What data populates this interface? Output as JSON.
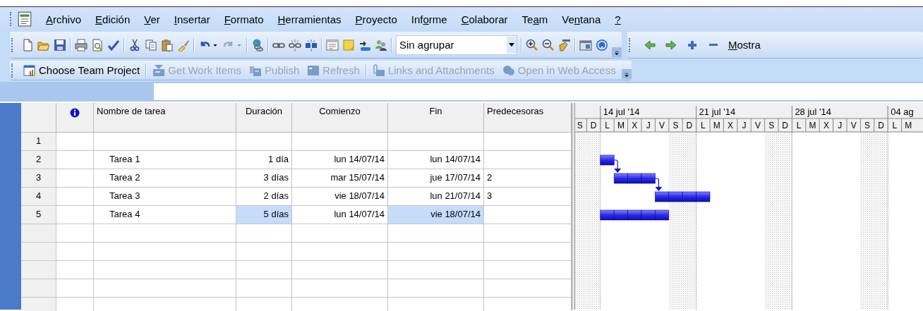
{
  "menu": [
    {
      "key": "A",
      "post": "rchivo"
    },
    {
      "key": "E",
      "post": "dición"
    },
    {
      "key": "V",
      "post": "er"
    },
    {
      "key": "I",
      "post": "nsertar"
    },
    {
      "key": "F",
      "post": "ormato"
    },
    {
      "key": "H",
      "post": "erramientas"
    },
    {
      "key": "P",
      "post": "royecto"
    },
    {
      "pre": "Inf",
      "key": "o",
      "post": "rme"
    },
    {
      "key": "C",
      "post": "olaborar"
    },
    {
      "pre": "Te",
      "key": "a",
      "post": "m"
    },
    {
      "pre": "Ve",
      "key": "n",
      "post": "tana"
    },
    {
      "key": "?"
    }
  ],
  "toolbar": {
    "group_combo": {
      "value": "Sin agrupar"
    },
    "show_menu": {
      "key": "M",
      "post": "ostra"
    }
  },
  "team_toolbar": [
    {
      "label": "Choose Team Project",
      "disabled": false,
      "separator_before": false
    },
    {
      "label": "Get Work Items",
      "disabled": true,
      "separator_before": true
    },
    {
      "label": "Publish",
      "disabled": true,
      "separator_before": false
    },
    {
      "label": "Refresh",
      "disabled": true,
      "separator_before": false
    },
    {
      "label": "Links and Attachments",
      "disabled": true,
      "separator_before": true
    },
    {
      "label": "Open in Web Access",
      "disabled": true,
      "separator_before": false
    }
  ],
  "table": {
    "columns": [
      {
        "label": "Nombre de tarea"
      },
      {
        "label": "Duración"
      },
      {
        "label": "Comienzo"
      },
      {
        "label": "Fin"
      },
      {
        "label": "Predecesoras"
      }
    ],
    "rows": [
      {
        "id": "1",
        "cells": [
          {
            "selected": false
          },
          {
            "selected": false
          },
          {
            "selected": false
          },
          {
            "selected": false
          },
          {
            "selected": false
          }
        ]
      },
      {
        "id": "2",
        "cells": [
          {
            "text": "Tarea 1",
            "selected": false
          },
          {
            "text": "1 día",
            "selected": false
          },
          {
            "text": "lun 14/07/14",
            "selected": false
          },
          {
            "text": "lun 14/07/14",
            "selected": false
          },
          {
            "selected": false
          }
        ]
      },
      {
        "id": "3",
        "cells": [
          {
            "text": "Tarea 2",
            "selected": false
          },
          {
            "text": "3 días",
            "selected": false
          },
          {
            "text": "mar 15/07/14",
            "selected": false
          },
          {
            "text": "jue 17/07/14",
            "selected": false
          },
          {
            "text": "2",
            "selected": false
          }
        ]
      },
      {
        "id": "4",
        "cells": [
          {
            "text": "Tarea 3",
            "selected": false
          },
          {
            "text": "2 días",
            "selected": false
          },
          {
            "text": "vie 18/07/14",
            "selected": false
          },
          {
            "text": "lun 21/07/14",
            "selected": false
          },
          {
            "text": "3",
            "selected": false
          }
        ]
      },
      {
        "id": "5",
        "cells": [
          {
            "text": "Tarea 4",
            "selected": false
          },
          {
            "text": "5 días",
            "selected": true
          },
          {
            "text": "lun 14/07/14",
            "selected": false
          },
          {
            "text": "vie 18/07/14",
            "selected": true
          },
          {
            "selected": false
          }
        ]
      }
    ]
  },
  "gantt": {
    "weeks": [
      {
        "label": "14 jul '14"
      },
      {
        "label": "21 jul '14"
      },
      {
        "label": "28 jul '14"
      },
      {
        "label": "04 ag"
      }
    ],
    "days": [
      {
        "letter": "S",
        "weekend": true
      },
      {
        "letter": "D",
        "weekend": true
      },
      {
        "letter": "L",
        "weekend": false
      },
      {
        "letter": "M",
        "weekend": false
      },
      {
        "letter": "X",
        "weekend": false
      },
      {
        "letter": "J",
        "weekend": false
      },
      {
        "letter": "V",
        "weekend": false
      },
      {
        "letter": "S",
        "weekend": true
      },
      {
        "letter": "D",
        "weekend": true
      },
      {
        "letter": "L",
        "weekend": false
      },
      {
        "letter": "M",
        "weekend": false
      },
      {
        "letter": "X",
        "weekend": false
      },
      {
        "letter": "J",
        "weekend": false
      },
      {
        "letter": "V",
        "weekend": false
      },
      {
        "letter": "S",
        "weekend": true
      },
      {
        "letter": "D",
        "weekend": true
      },
      {
        "letter": "L",
        "weekend": false
      },
      {
        "letter": "M",
        "weekend": false
      },
      {
        "letter": "X",
        "weekend": false
      },
      {
        "letter": "J",
        "weekend": false
      },
      {
        "letter": "V",
        "weekend": false
      },
      {
        "letter": "S",
        "weekend": true
      },
      {
        "letter": "D",
        "weekend": true
      },
      {
        "letter": "L",
        "weekend": false
      },
      {
        "letter": "M",
        "weekend": false
      }
    ],
    "bars": [
      {
        "link_to_next": true,
        "days": [
          false,
          false,
          true
        ]
      },
      {
        "link_to_next": true,
        "days": [
          false,
          false,
          false,
          true,
          true,
          true
        ]
      },
      {
        "link_to_next": false,
        "days": [
          false,
          false,
          false,
          false,
          false,
          false,
          true,
          true,
          true,
          true
        ]
      },
      {
        "link_to_next": false,
        "days": [
          false,
          false,
          true,
          true,
          true,
          true,
          true
        ]
      }
    ]
  }
}
